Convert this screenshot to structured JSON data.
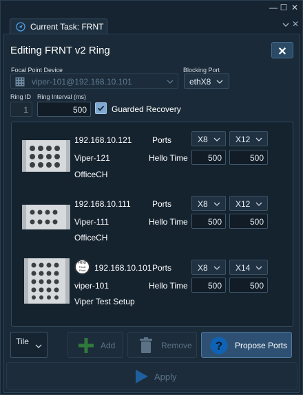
{
  "window": {
    "controls": {
      "minimize": "—",
      "maximize": "☐",
      "close": "✕"
    },
    "tab_label": "Current Task: FRNT",
    "tabbar_close": "✕"
  },
  "form": {
    "title": "Editing FRNT v2 Ring",
    "close_symbol": "✕",
    "focal_point_label": "Focal Point Device",
    "focal_point_value": "viper-101@192.168.10.101",
    "blocking_port_label": "Blocking Port",
    "blocking_port_value": "ethX8",
    "ring_id_label": "Ring ID",
    "ring_id_value": "1",
    "ring_interval_label": "Ring Interval (ms)",
    "ring_interval_value": "500",
    "guarded_recovery_label": "Guarded Recovery",
    "guarded_recovery_checked": true
  },
  "labels": {
    "ports": "Ports",
    "hello_time": "Hello Time"
  },
  "devices": [
    {
      "ip": "192.168.10.121",
      "name": "Viper-121",
      "location": "OfficeCH",
      "port_a": "X8",
      "port_b": "X12",
      "hello_a": "500",
      "hello_b": "500",
      "focal": false
    },
    {
      "ip": "192.168.10.111",
      "name": "Viper-111",
      "location": "OfficeCH",
      "port_a": "X8",
      "port_b": "X12",
      "hello_a": "500",
      "hello_b": "500",
      "focal": false
    },
    {
      "ip": "192.168.10.101",
      "name": "viper-101",
      "location": "Viper Test Setup",
      "port_a": "X8",
      "port_b": "X14",
      "hello_a": "500",
      "hello_b": "500",
      "focal": true,
      "focal_badge": [
        "FRNT",
        "Focal",
        "Point"
      ]
    }
  ],
  "toolbar": {
    "layout_value": "Tile",
    "add_label": "Add",
    "remove_label": "Remove",
    "propose_label": "Propose Ports",
    "apply_label": "Apply"
  },
  "colors": {
    "background": "#162330",
    "panel": "#1a2a38",
    "accent": "#2e5173",
    "checkbox": "#7fa9d2",
    "add_icon": "#2f7a3a",
    "disabled_text": "#5b7287"
  },
  "icons": {
    "tab": "navigation-arrow-icon",
    "focal_device": "device-grid-icon",
    "dropdown": "chevron-down-icon",
    "add": "plus-icon",
    "remove": "trash-icon",
    "propose": "question-icon",
    "apply": "play-icon"
  }
}
